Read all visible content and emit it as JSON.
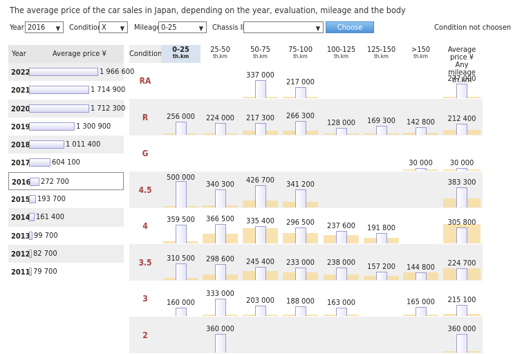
{
  "title": "The average price of the car sales in Japan, depending on the year, evaluation, mileage and the body",
  "filters": {
    "year_label": "Year",
    "year_value": "2016",
    "condition_label": "Condition",
    "condition_value": "X",
    "mileage_label": "Mileage",
    "mileage_value": "0-25",
    "chassis_label": "Chassis ID",
    "chassis_value": "",
    "choose_label": "Choose",
    "condition_note": "Condition not choosen"
  },
  "years_table": {
    "col_year": "Year",
    "col_price": "Average price ¥",
    "max": 1966600,
    "rows": [
      {
        "year": "2022",
        "value": 1966600,
        "label": "1 966 600"
      },
      {
        "year": "2021",
        "value": 1714900,
        "label": "1 714 900"
      },
      {
        "year": "2020",
        "value": 1712300,
        "label": "1 712 300"
      },
      {
        "year": "2019",
        "value": 1300900,
        "label": "1 300 900"
      },
      {
        "year": "2018",
        "value": 1011400,
        "label": "1 011 400"
      },
      {
        "year": "2017",
        "value": 604100,
        "label": "604 100"
      },
      {
        "year": "2016",
        "value": 272700,
        "label": "272 700",
        "selected": true
      },
      {
        "year": "2015",
        "value": 193700,
        "label": "193 700"
      },
      {
        "year": "2014",
        "value": 161400,
        "label": "161 400"
      },
      {
        "year": "2013",
        "value": 99700,
        "label": "99 700"
      },
      {
        "year": "2012",
        "value": 82700,
        "label": "82 700"
      },
      {
        "year": "2011",
        "value": 79700,
        "label": "79 700"
      }
    ]
  },
  "grid": {
    "condition_header": "Condition",
    "unit": "th.km",
    "avg_header_line1": "Average price ¥",
    "avg_header_line2": "Any mileage th.km",
    "mileage_columns": [
      "0-25",
      "25-50",
      "50-75",
      "75-100",
      "100-125",
      "125-150",
      ">150"
    ],
    "active_column": 0,
    "max": 500000,
    "rows": [
      {
        "condition": "RA",
        "cells": [
          "",
          "",
          "337 000",
          "217 000",
          "",
          "",
          ""
        ],
        "avg": "277 000"
      },
      {
        "condition": "R",
        "cells": [
          "256 000",
          "224 000",
          "217 300",
          "266 300",
          "128 000",
          "169 300",
          "142 800"
        ],
        "avg": "212 400"
      },
      {
        "condition": "G",
        "cells": [
          "",
          "",
          "",
          "",
          "",
          "",
          "30 000"
        ],
        "avg": "30 000"
      },
      {
        "condition": "4.5",
        "cells": [
          "500 000",
          "340 300",
          "426 700",
          "341 200",
          "",
          "",
          ""
        ],
        "avg": "383 300"
      },
      {
        "condition": "4",
        "cells": [
          "359 500",
          "366 500",
          "335 400",
          "296 500",
          "237 600",
          "191 800",
          ""
        ],
        "avg": "305 800"
      },
      {
        "condition": "3.5",
        "cells": [
          "310 500",
          "298 600",
          "245 400",
          "233 000",
          "238 000",
          "157 200",
          "144 800"
        ],
        "avg": "224 700"
      },
      {
        "condition": "3",
        "cells": [
          "160 000",
          "333 000",
          "203 000",
          "188 000",
          "163 000",
          "",
          "165 000"
        ],
        "avg": "215 100"
      },
      {
        "condition": "2",
        "cells": [
          "",
          "360 000",
          "",
          "",
          "",
          "",
          ""
        ],
        "avg": "360 000"
      }
    ],
    "volume": [
      [
        0,
        0,
        0.04,
        0.03,
        0,
        0,
        0,
        0.05
      ],
      [
        0.04,
        0.06,
        0.2,
        0.2,
        0.04,
        0.08,
        0.1,
        0.25
      ],
      [
        0,
        0,
        0,
        0,
        0,
        0,
        0.02,
        0.02
      ],
      [
        0.08,
        0.12,
        0.34,
        0.28,
        0,
        0,
        0,
        0.48
      ],
      [
        0.12,
        0.5,
        0.8,
        0.55,
        0.42,
        0.3,
        0,
        1.0
      ],
      [
        0.1,
        0.28,
        0.45,
        0.4,
        0.3,
        0.22,
        0.38,
        0.6
      ],
      [
        0,
        0.04,
        0.06,
        0.06,
        0.03,
        0,
        0.04,
        0.1
      ],
      [
        0,
        0,
        0,
        0,
        0,
        0,
        0,
        0.02
      ]
    ]
  }
}
